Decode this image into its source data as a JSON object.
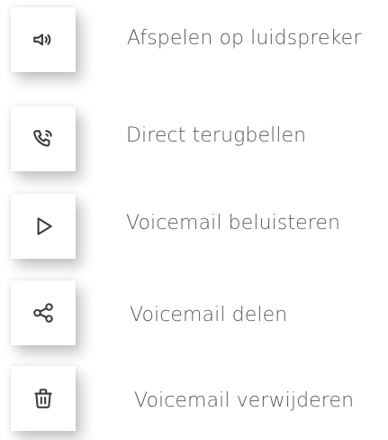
{
  "actions": [
    {
      "icon": "speaker-icon",
      "label": "Afspelen op luidspreker"
    },
    {
      "icon": "phone-callback-icon",
      "label": "Direct terugbellen"
    },
    {
      "icon": "play-icon",
      "label": "Voicemail beluisteren"
    },
    {
      "icon": "share-icon",
      "label": "Voicemail delen"
    },
    {
      "icon": "trash-icon",
      "label": "Voicemail verwijderen"
    }
  ]
}
